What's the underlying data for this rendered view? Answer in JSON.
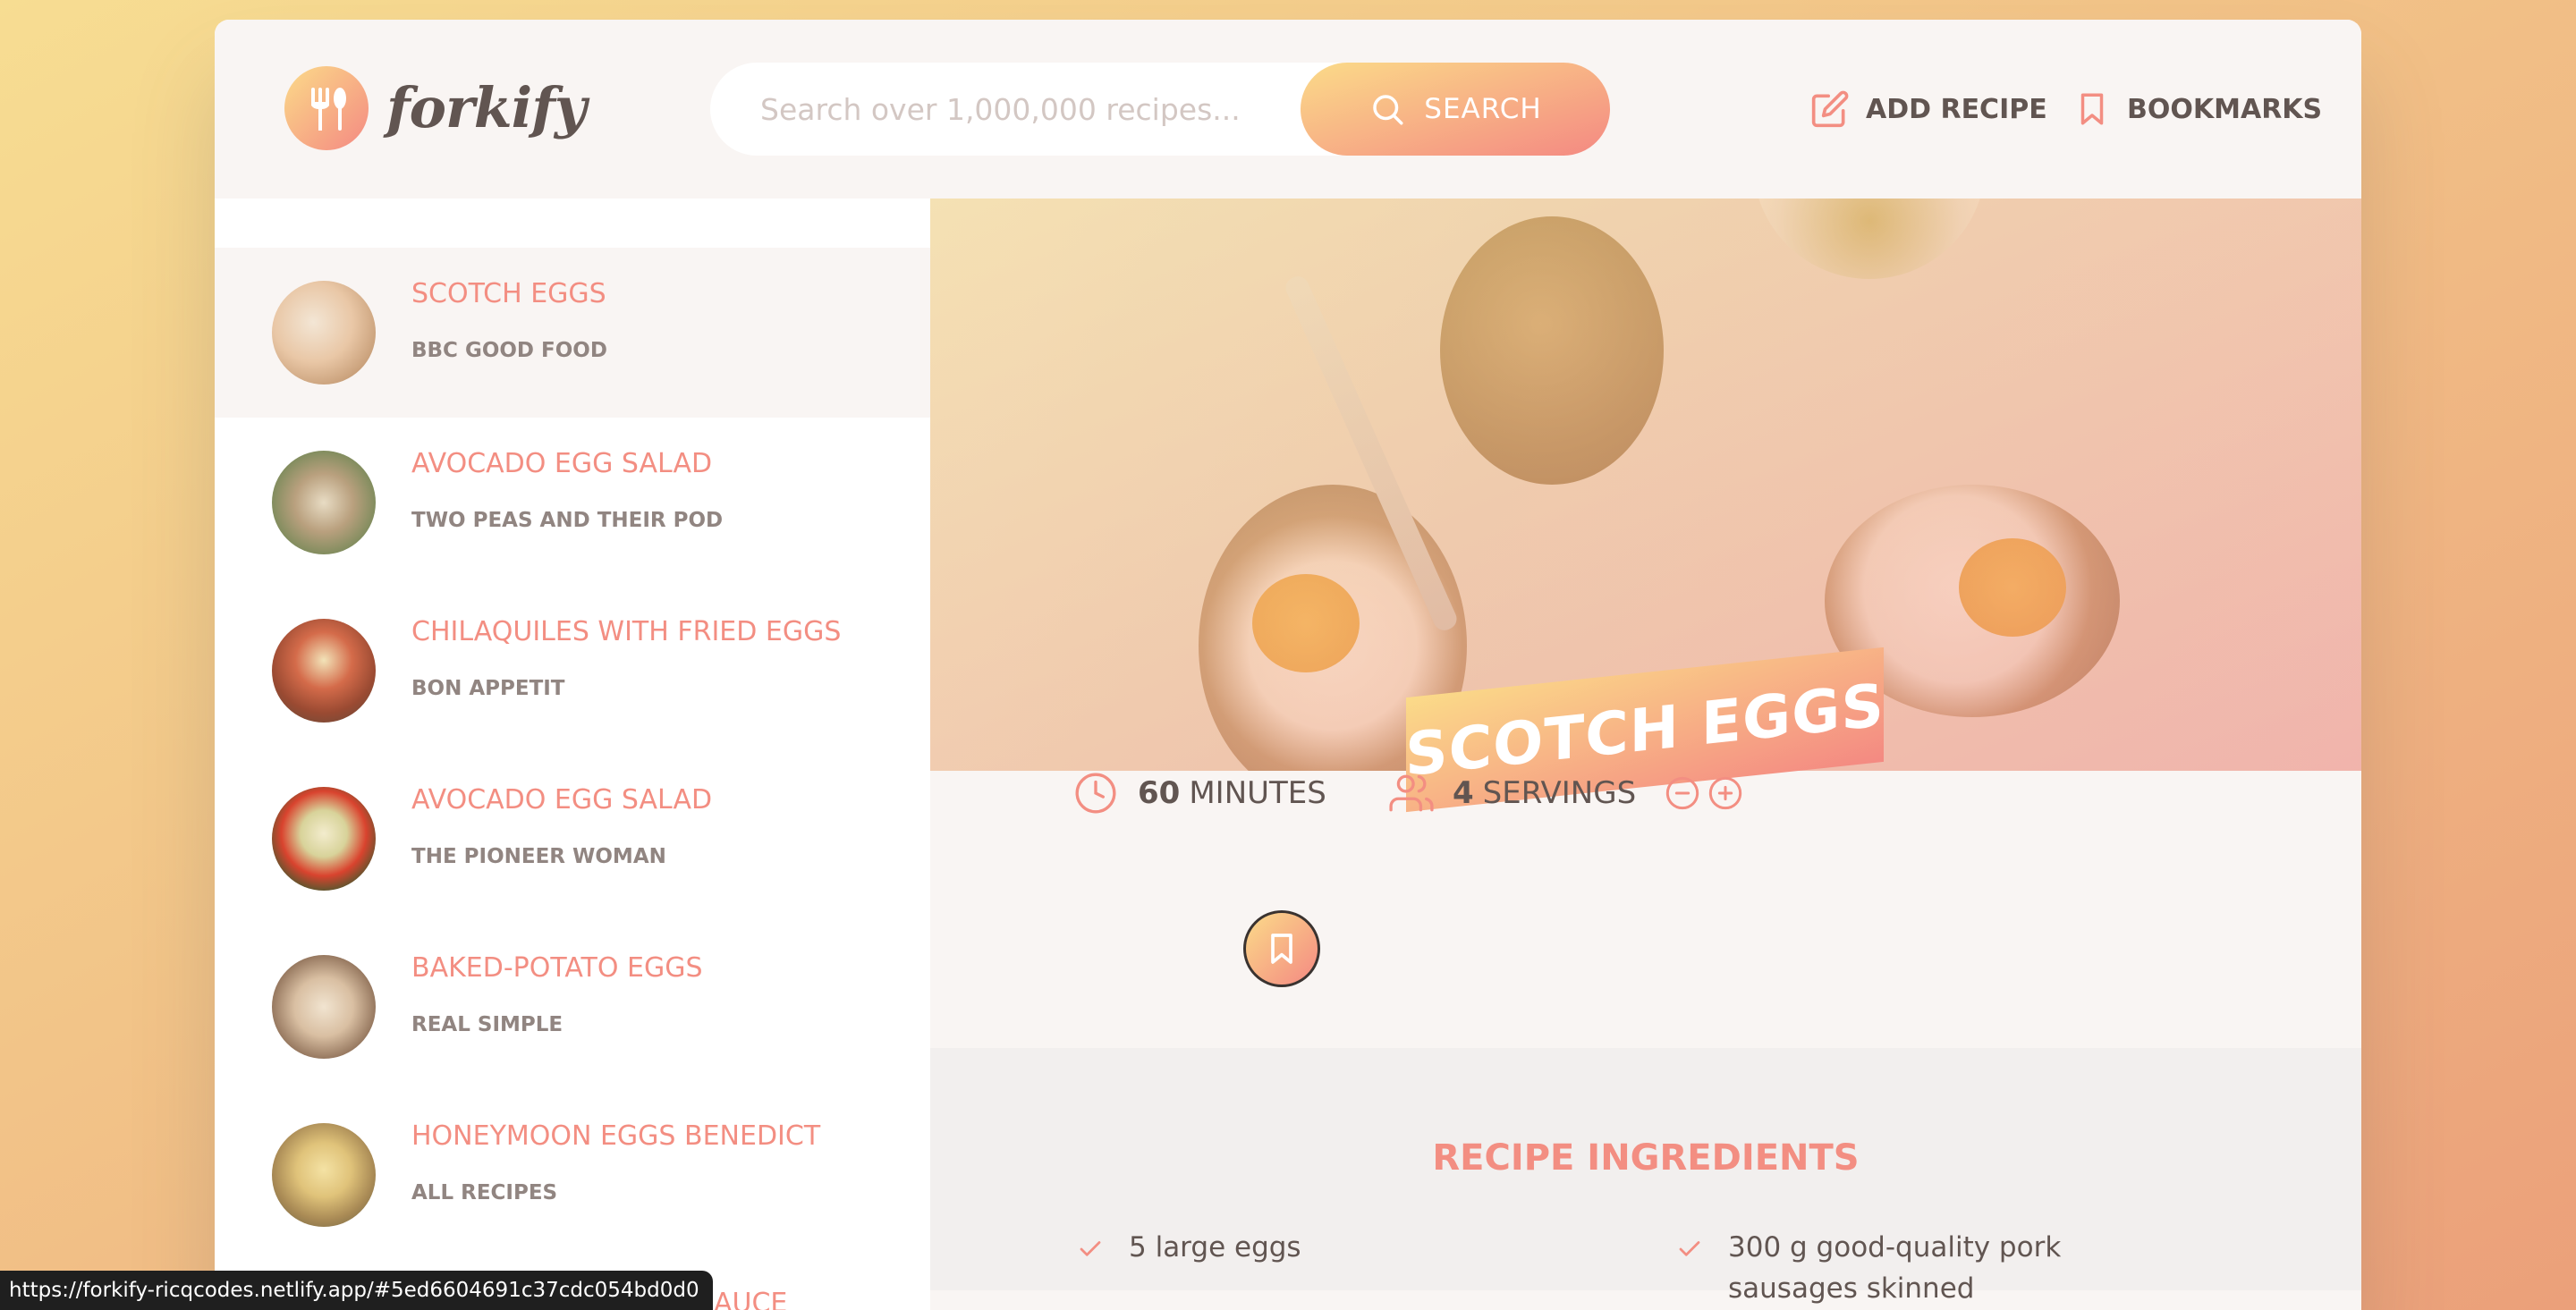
{
  "header": {
    "logo_text": "forkify",
    "search": {
      "placeholder": "Search over 1,000,000 recipes...",
      "button_label": "SEARCH"
    },
    "nav": {
      "add_recipe": "ADD RECIPE",
      "bookmarks": "BOOKMARKS"
    }
  },
  "results": [
    {
      "title": "SCOTCH EGGS",
      "publisher": "BBC GOOD FOOD",
      "active": true
    },
    {
      "title": "AVOCADO EGG SALAD",
      "publisher": "TWO PEAS AND THEIR POD"
    },
    {
      "title": "CHILAQUILES WITH FRIED EGGS",
      "publisher": "BON APPETIT"
    },
    {
      "title": "AVOCADO EGG SALAD",
      "publisher": "THE PIONEER WOMAN"
    },
    {
      "title": "BAKED-POTATO EGGS",
      "publisher": "REAL SIMPLE"
    },
    {
      "title": "HONEYMOON EGGS BENEDICT",
      "publisher": "ALL RECIPES"
    }
  ],
  "recipe": {
    "title": "SCOTCH EGGS",
    "cooking_time": "60",
    "cooking_time_unit": "MINUTES",
    "servings": "4",
    "servings_unit": "SERVINGS",
    "ingredients_heading": "RECIPE INGREDIENTS",
    "ingredients": [
      "5 large eggs",
      "300 g good-quality pork sausages skinned"
    ]
  },
  "status_bar": {
    "url": "https://forkify-ricqcodes.netlify.app/#5ed6604691c37cdc054bd0d0",
    "hidden_text": "AUCE"
  },
  "colors": {
    "accent_start": "#fbdb89",
    "accent_end": "#f48982",
    "title_text": "#f38e82",
    "body_text": "#615551"
  },
  "icons": {
    "logo": "fork-spoon-icon",
    "search": "search-icon",
    "add_recipe": "edit-icon",
    "bookmarks": "bookmark-icon",
    "time": "clock-icon",
    "servings": "users-icon",
    "decrease": "minus-circle-icon",
    "increase": "plus-circle-icon",
    "bookmark_recipe": "bookmark-icon",
    "ingredient": "check-icon"
  }
}
